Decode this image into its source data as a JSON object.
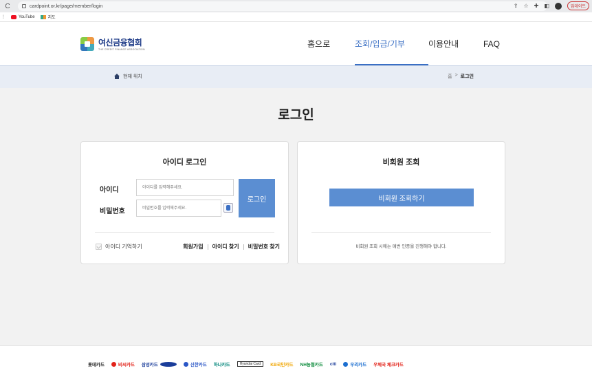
{
  "browser": {
    "url": "cardpoint.or.kr/page/member/login",
    "update_label": "업데이트",
    "bookmarks": [
      {
        "label": "YouTube"
      },
      {
        "label": "지도"
      }
    ]
  },
  "header": {
    "logo_name": "여신금융협회",
    "logo_sub": "THE CREDIT FINANCE ASSOCIATION",
    "nav": [
      {
        "label": "홈으로"
      },
      {
        "label": "조회/입금/기부"
      },
      {
        "label": "이용안내"
      },
      {
        "label": "FAQ"
      }
    ]
  },
  "breadcrumb": {
    "location_label": "현재 위치",
    "home": "홈",
    "separator": ">",
    "current": "로그인"
  },
  "page_title": "로그인",
  "login_card": {
    "title": "아이디 로그인",
    "id_label": "아이디",
    "id_placeholder": "아이디를 입력해주세요.",
    "pw_label": "비밀번호",
    "pw_placeholder": "비밀번호를 입력해주세요.",
    "login_button": "로그인",
    "remember_label": "아이디 기억하기",
    "links": [
      "회원가입",
      "아이디 찾기",
      "비밀번호 찾기"
    ]
  },
  "guest_card": {
    "title": "비회원 조회",
    "button": "비회원 조회하기",
    "note": "비회원 조회 시에는 매번 인증을 진행해야 합니다."
  },
  "partners": [
    {
      "label": "롯데카드",
      "color": "#222222"
    },
    {
      "label": "비씨카드",
      "color": "#e2231a"
    },
    {
      "label": "삼성카드",
      "color": "#1a3d9a"
    },
    {
      "label": "신한카드",
      "color": "#2a56c6"
    },
    {
      "label": "하나카드",
      "color": "#00857a"
    },
    {
      "label": "Hyundai Card",
      "color": "#222222"
    },
    {
      "label": "KB국민카드",
      "color": "#f0a500"
    },
    {
      "label": "NH농협카드",
      "color": "#0a8a3a"
    },
    {
      "label": "citi",
      "color": "#1a3d9a"
    },
    {
      "label": "우리카드",
      "color": "#1c6fd0"
    },
    {
      "label": "우체국 체크카드",
      "color": "#e2231a"
    }
  ]
}
